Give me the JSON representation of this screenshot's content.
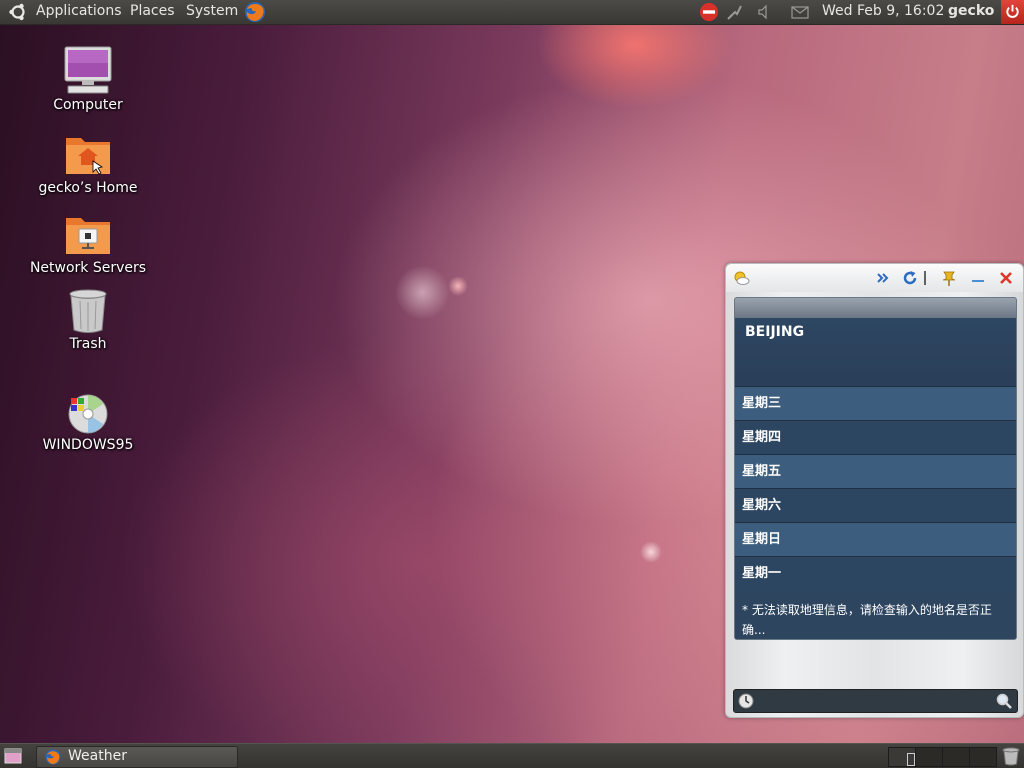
{
  "top_panel": {
    "menus": [
      "Applications",
      "Places",
      "System"
    ],
    "clock": "Wed Feb  9, 16:02",
    "user": "gecko",
    "icons": [
      "ubuntu-logo-icon",
      "firefox-icon",
      "do-not-disturb-icon",
      "network-icon",
      "volume-icon",
      "mail-icon",
      "power-icon"
    ]
  },
  "desktop": {
    "icons": [
      {
        "label": "Computer",
        "icon": "computer-icon"
      },
      {
        "label": "gecko’s Home",
        "icon": "home-folder-icon"
      },
      {
        "label": "Network Servers",
        "icon": "network-folder-icon"
      },
      {
        "label": "Trash",
        "icon": "trash-icon"
      },
      {
        "label": "WINDOWS95",
        "icon": "cd-icon"
      }
    ]
  },
  "weather": {
    "city": "BEIJING",
    "days": [
      "星期三",
      "星期四",
      "星期五",
      "星期六",
      "星期日",
      "星期一"
    ],
    "message": "* 无法读取地理信息，请检查输入的地名是否正确...",
    "search_value": "",
    "buttons": [
      "weather-icon",
      "forward-icon",
      "refresh-icon",
      "pin-icon",
      "minimize-icon",
      "close-icon"
    ]
  },
  "bottom_panel": {
    "task_label": "Weather",
    "workspaces": 4
  },
  "colors": {
    "panel": "#3f3e3a",
    "widget_dark": "#334a63",
    "close_red": "#e0362a",
    "refresh_blue": "#2d6cc0"
  }
}
